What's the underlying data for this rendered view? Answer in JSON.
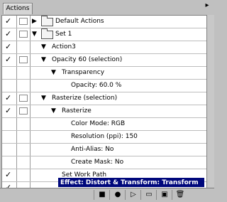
{
  "panel": {
    "tab_label": "Actions",
    "menu_icon": "triangle-right"
  },
  "rows": [
    {
      "label": "Default Actions",
      "check": "✓",
      "triangle": "▶",
      "folder": true
    },
    {
      "label": "Set 1",
      "check": "✓",
      "triangle": "▼",
      "folder": true
    },
    {
      "label": "Action3",
      "check": "✓",
      "triangle": "▼"
    },
    {
      "label": "Opacity 60 (selection)",
      "check": "✓",
      "triangle": "▼"
    },
    {
      "label": "Transparency",
      "check": "",
      "triangle": "▼"
    },
    {
      "label": "Opacity: 60.0 %",
      "check": ""
    },
    {
      "label": "Rasterize (selection)",
      "check": "✓",
      "triangle": "▼"
    },
    {
      "label": "Rasterize",
      "check": "✓",
      "triangle": "▼"
    },
    {
      "label": "Color Mode: RGB",
      "check": ""
    },
    {
      "label": "Resolution (ppi): 150",
      "check": ""
    },
    {
      "label": "Anti-Alias: No",
      "check": ""
    },
    {
      "label": "Create Mask: No",
      "check": ""
    },
    {
      "label": "Set Work Path",
      "check": "✓"
    },
    {
      "label": "Effect: Distort & Transform: Transform",
      "check": "✓",
      "selected": true
    }
  ],
  "toolbar": {
    "stop": "■",
    "record": "●",
    "play": "▷",
    "new_set": "▭",
    "new_action": "▣",
    "delete": "🗑"
  }
}
